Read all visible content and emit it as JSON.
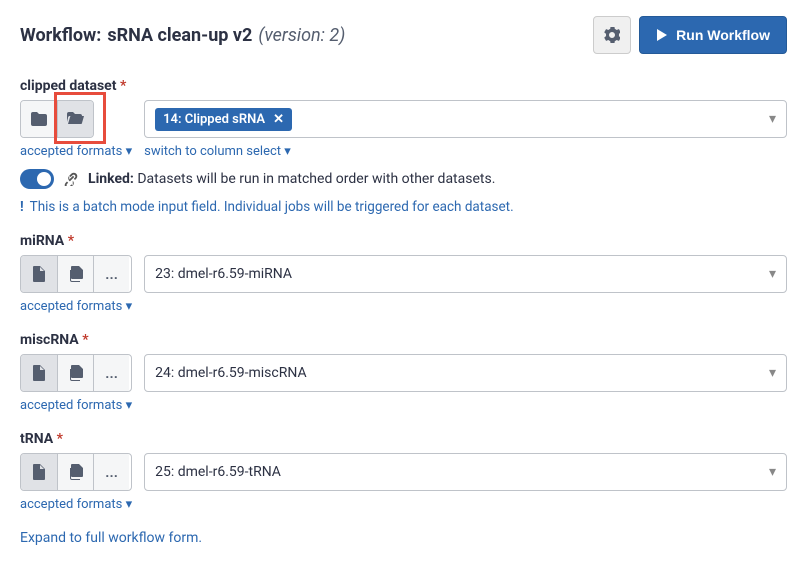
{
  "header": {
    "title_prefix": "Workflow:",
    "title_name": "sRNA clean-up v2",
    "title_version": "(version: 2)",
    "run_label": "Run Workflow"
  },
  "fields": {
    "clipped": {
      "label": "clipped dataset",
      "tag": "14: Clipped sRNA",
      "accepted_formats": "accepted formats",
      "column_select": "switch to column select"
    },
    "linked": {
      "label": "Linked:",
      "text": "Datasets will be run in matched order with other datasets."
    },
    "batch_hint": "This is a batch mode input field. Individual jobs will be triggered for each dataset.",
    "mirna": {
      "label": "miRNA",
      "value": "23: dmel-r6.59-miRNA",
      "accepted_formats": "accepted formats"
    },
    "miscrna": {
      "label": "miscRNA",
      "value": "24: dmel-r6.59-miscRNA",
      "accepted_formats": "accepted formats"
    },
    "trna": {
      "label": "tRNA",
      "value": "25: dmel-r6.59-tRNA",
      "accepted_formats": "accepted formats"
    }
  },
  "expand_link": "Expand to full workflow form."
}
